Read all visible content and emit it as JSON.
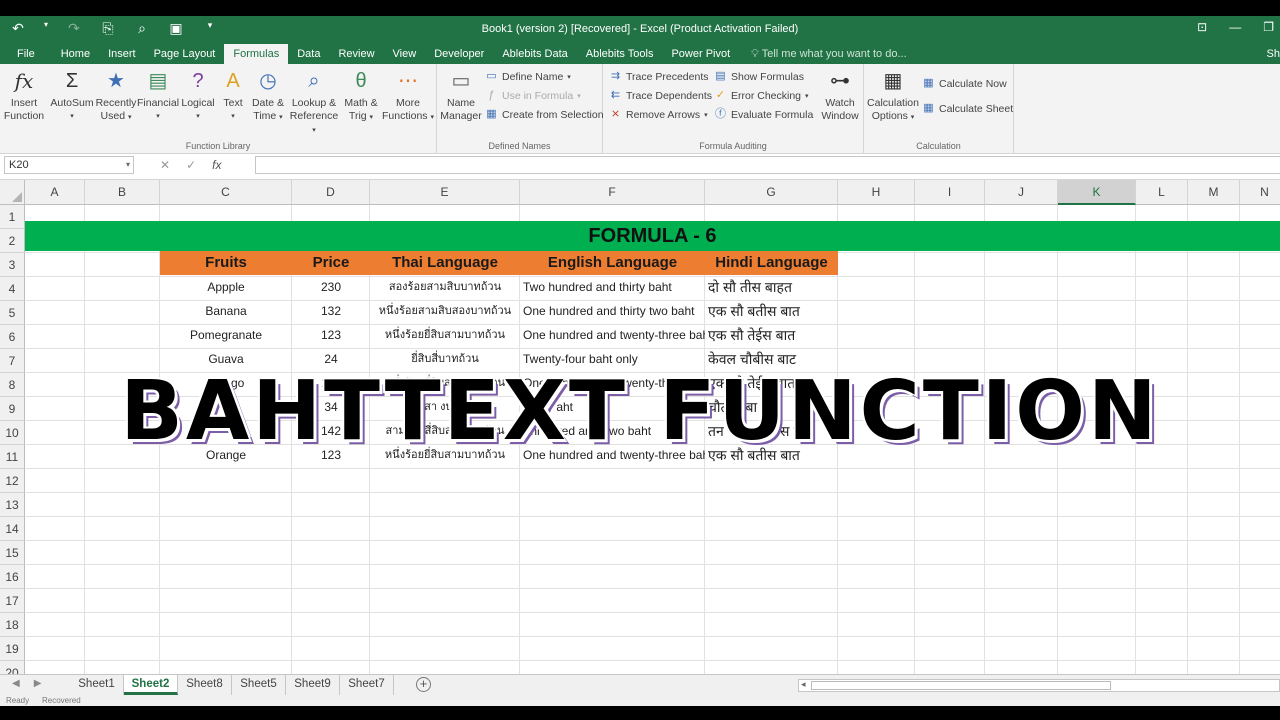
{
  "window": {
    "title": "Book1 (version 2) [Recovered] - Excel (Product Activation Failed)",
    "qat_icons": [
      "undo-icon",
      "redo-icon",
      "save-as-icon",
      "print-preview-icon",
      "save-icon",
      "customize-qat-icon"
    ]
  },
  "tabs": [
    "File",
    "Home",
    "Insert",
    "Page Layout",
    "Formulas",
    "Data",
    "Review",
    "View",
    "Developer",
    "Ablebits Data",
    "Ablebits Tools",
    "Power Pivot"
  ],
  "active_tab": "Formulas",
  "tell_me": "Tell me what you want to do...",
  "share": "Sh",
  "ribbon": {
    "function_library": {
      "label": "Function Library",
      "insert_function": [
        "Insert",
        "Function"
      ],
      "autosum": "AutoSum",
      "recently_used": [
        "Recently",
        "Used"
      ],
      "financial": "Financial",
      "logical": "Logical",
      "text": "Text",
      "date_time": [
        "Date &",
        "Time"
      ],
      "lookup_reference": [
        "Lookup &",
        "Reference"
      ],
      "math_trig": [
        "Math &",
        "Trig"
      ],
      "more_functions": [
        "More",
        "Functions"
      ]
    },
    "defined_names": {
      "label": "Defined Names",
      "name_manager": [
        "Name",
        "Manager"
      ],
      "define_name": "Define Name",
      "use_in_formula": "Use in Formula",
      "create_from_selection": "Create from Selection"
    },
    "formula_auditing": {
      "label": "Formula Auditing",
      "trace_precedents": "Trace Precedents",
      "trace_dependents": "Trace Dependents",
      "remove_arrows": "Remove Arrows",
      "show_formulas": "Show Formulas",
      "error_checking": "Error Checking",
      "evaluate_formula": "Evaluate Formula",
      "watch_window": [
        "Watch",
        "Window"
      ]
    },
    "calculation": {
      "label": "Calculation",
      "calculation_options": [
        "Calculation",
        "Options"
      ],
      "calculate_now": "Calculate Now",
      "calculate_sheet": "Calculate Sheet"
    }
  },
  "formula_bar": {
    "name_box": "K20",
    "formula": ""
  },
  "columns": [
    "A",
    "B",
    "C",
    "D",
    "E",
    "F",
    "G",
    "H",
    "I",
    "J",
    "K",
    "L",
    "M",
    "N"
  ],
  "rows": [
    "1",
    "2",
    "3",
    "4",
    "5",
    "6",
    "7",
    "8",
    "9",
    "10",
    "11",
    "12",
    "13",
    "14",
    "15",
    "16",
    "17",
    "18",
    "19",
    "20"
  ],
  "sheet": {
    "banner": "FORMULA - 6",
    "headers": [
      "Fruits",
      "Price",
      "Thai  Language",
      "English  Language",
      "Hindi  Language"
    ],
    "data": [
      [
        "Appple",
        "230",
        "สองร้อยสามสิบบาทถ้วน",
        "Two hundred and thirty baht",
        "दो सौ तीस बाहत"
      ],
      [
        "Banana",
        "132",
        "หนึ่งร้อยสามสิบสองบาทถ้วน",
        "One hundred and thirty two baht",
        "एक सौ बतीस बात"
      ],
      [
        "Pomegranate",
        "123",
        "หนึ่งร้อยยี่สิบสามบาทถ้วน",
        "One hundred and twenty-three baht",
        "एक सौ तेईस बात"
      ],
      [
        "Guava",
        "24",
        "ยี่สิบสี่บาทถ้วน",
        "Twenty-four baht only",
        "केवल चौबीस बाट"
      ],
      [
        "Mango",
        "123",
        "หนึ่งร้อยยี่สิบสามบาทถ้วน",
        "One hundred and twenty-three baht",
        "एक सौ तेईस बात"
      ],
      [
        "",
        "34",
        "สา             งบาท",
        "Thirty          aht",
        "चौतीस बा"
      ],
      [
        "",
        "142",
        "สามร้อยสี่สิบสองบาทถ้วน",
        "Thre       dred and       -two baht",
        "तन सौ बया    ीस बात"
      ],
      [
        "Orange",
        "123",
        "หนึ่งร้อยยี่สิบสามบาทถ้วน",
        "One hundred and twenty-three baht",
        "एक सौ बतीस बात"
      ]
    ]
  },
  "overlay_text": "BAHTTEXT FUNCTION",
  "sheet_tabs": [
    "Sheet1",
    "Sheet2",
    "Sheet8",
    "Sheet5",
    "Sheet9",
    "Sheet7"
  ],
  "active_sheet": "Sheet2",
  "status": {
    "ready": "Ready",
    "recovered": "Recovered"
  },
  "colors": {
    "excel_green": "#217346",
    "banner_green": "#00b050",
    "header_orange": "#ed7d31",
    "overlay_shadow": "#7b5ea7"
  }
}
